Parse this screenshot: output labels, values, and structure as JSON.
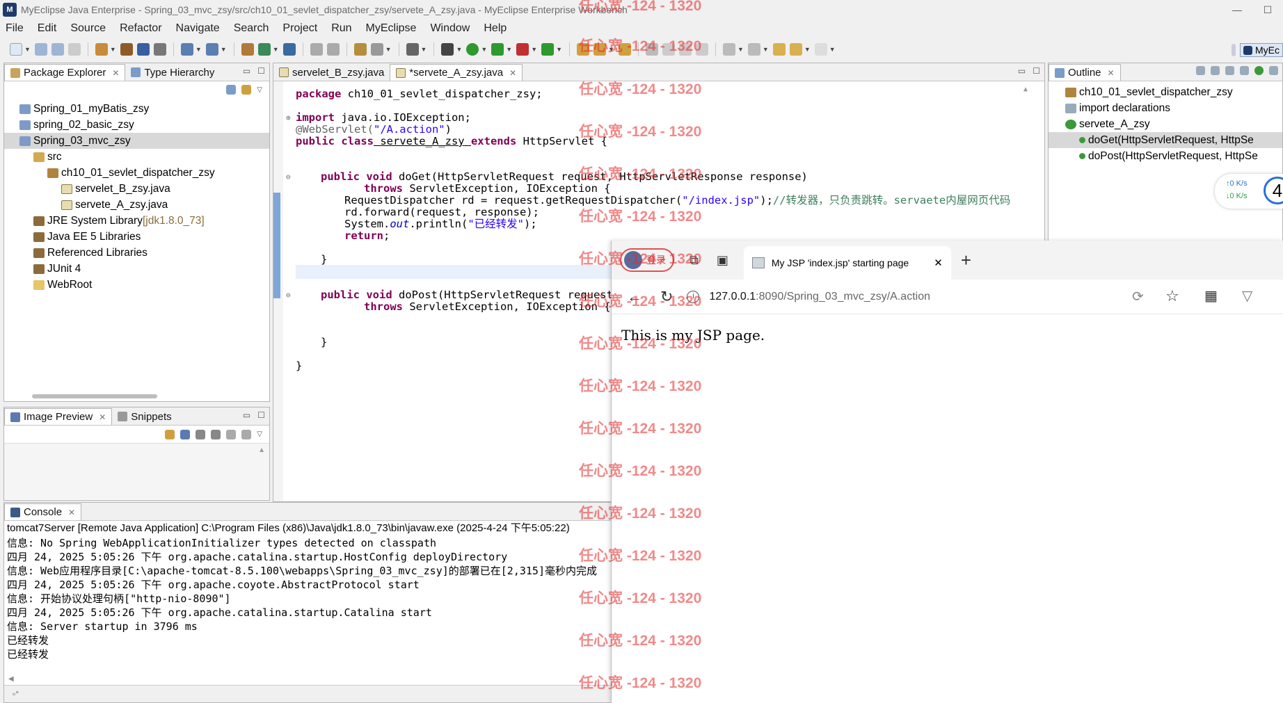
{
  "window": {
    "title": "MyEclipse Java Enterprise - Spring_03_mvc_zsy/src/ch10_01_sevlet_dispatcher_zsy/servete_A_zsy.java - MyEclipse Enterprise Workbench",
    "minimize": "—",
    "maximize": "☐"
  },
  "menu": [
    "File",
    "Edit",
    "Source",
    "Refactor",
    "Navigate",
    "Search",
    "Project",
    "Run",
    "MyEclipse",
    "Window",
    "Help"
  ],
  "perspective_label": "MyEc",
  "package_explorer": {
    "tabs": [
      "Package Explorer",
      "Type Hierarchy"
    ],
    "tree": [
      {
        "label": "Spring_01_myBatis_zsy",
        "suffix": ""
      },
      {
        "label": "spring_02_basic_zsy",
        "suffix": ""
      },
      {
        "label": "Spring_03_mvc_zsy",
        "suffix": ""
      },
      {
        "label": "src",
        "suffix": ""
      },
      {
        "label": "ch10_01_sevlet_dispatcher_zsy",
        "suffix": ""
      },
      {
        "label": "servelet_B_zsy.java",
        "suffix": ""
      },
      {
        "label": "servete_A_zsy.java",
        "suffix": ""
      },
      {
        "label": "JRE System Library ",
        "suffix": "[jdk1.8.0_73]"
      },
      {
        "label": "Java EE 5 Libraries",
        "suffix": ""
      },
      {
        "label": "Referenced Libraries",
        "suffix": ""
      },
      {
        "label": "JUnit 4",
        "suffix": ""
      },
      {
        "label": "WebRoot",
        "suffix": ""
      }
    ]
  },
  "image_preview": {
    "tabs": [
      "Image Preview",
      "Snippets"
    ]
  },
  "editor": {
    "tabs": [
      "servelet_B_zsy.java",
      "*servete_A_zsy.java"
    ],
    "lines": {
      "l1_kw": "package",
      "l1_rest": " ch10_01_sevlet_dispatcher_zsy;",
      "l2_kw": "import",
      "l2_rest": " java.io.IOException;",
      "l3_ann": "@WebServlet(",
      "l3_str": "\"/A.action\"",
      "l3_end": ")",
      "l4_kw1": "public class",
      "l4_name": " servete_A_zsy ",
      "l4_kw2": "extends",
      "l4_rest": " HttpServlet {",
      "l5_kw": "public void",
      "l5_rest": " doGet(HttpServletRequest request, HttpServletResponse response)",
      "l6_kw": "throws",
      "l6_rest": " ServletException, IOException {",
      "l7_a": "RequestDispatcher rd = request.getRequestDispatcher(",
      "l7_str": "\"/index.jsp\"",
      "l7_b": ");",
      "l7_cmt": "//转发器，只负责跳转。servaete内屋网页代码",
      "l8": "rd.forward(request, response);",
      "l9_a": "System.",
      "l9_out": "out",
      "l9_b": ".println(",
      "l9_str": "\"已经转发\"",
      "l9_c": ");",
      "l10_kw": "return",
      "l10_rest": ";",
      "l11": "}",
      "l12_kw": "public void",
      "l12_rest": " doPost(HttpServletRequest request,",
      "l13_kw": "throws",
      "l13_rest": " ServletException, IOException {",
      "l14": "}",
      "l15": "}"
    }
  },
  "outline": {
    "tab": "Outline",
    "items": [
      "ch10_01_sevlet_dispatcher_zsy",
      "import declarations",
      "servete_A_zsy",
      "doGet(HttpServletRequest, HttpSe",
      "doPost(HttpServletRequest, HttpSe"
    ]
  },
  "speed_widget": {
    "up": "↑0  K/s",
    "down": "↓0  K/s",
    "big": "4"
  },
  "console": {
    "tab": "Console",
    "header": "tomcat7Server [Remote Java Application] C:\\Program Files (x86)\\Java\\jdk1.8.0_73\\bin\\javaw.exe (2025-4-24 下午5:05:22)",
    "lines": [
      "信息: No Spring WebApplicationInitializer types detected on classpath",
      "四月 24, 2025 5:05:26 下午 org.apache.catalina.startup.HostConfig deployDirectory",
      "信息: Web应用程序目录[C:\\apache-tomcat-8.5.100\\webapps\\Spring_03_mvc_zsy]的部署已在[2,315]毫秒内完成",
      "四月 24, 2025 5:05:26 下午 org.apache.coyote.AbstractProtocol start",
      "信息: 开始协议处理句柄[\"http-nio-8090\"]",
      "四月 24, 2025 5:05:26 下午 org.apache.catalina.startup.Catalina start",
      "信息: Server startup in 3796 ms",
      "已经转发",
      "已经转发"
    ]
  },
  "browser": {
    "login": "登录",
    "tab_title": "My JSP 'index.jsp' starting page",
    "close": "✕",
    "new_tab": "+",
    "url_host": "127.0.0.1",
    "url_rest": ":8090/Spring_03_mvc_zsy/A.action",
    "page_text": "This is my JSP page."
  },
  "watermark": "任心宽 -124 - 1320"
}
